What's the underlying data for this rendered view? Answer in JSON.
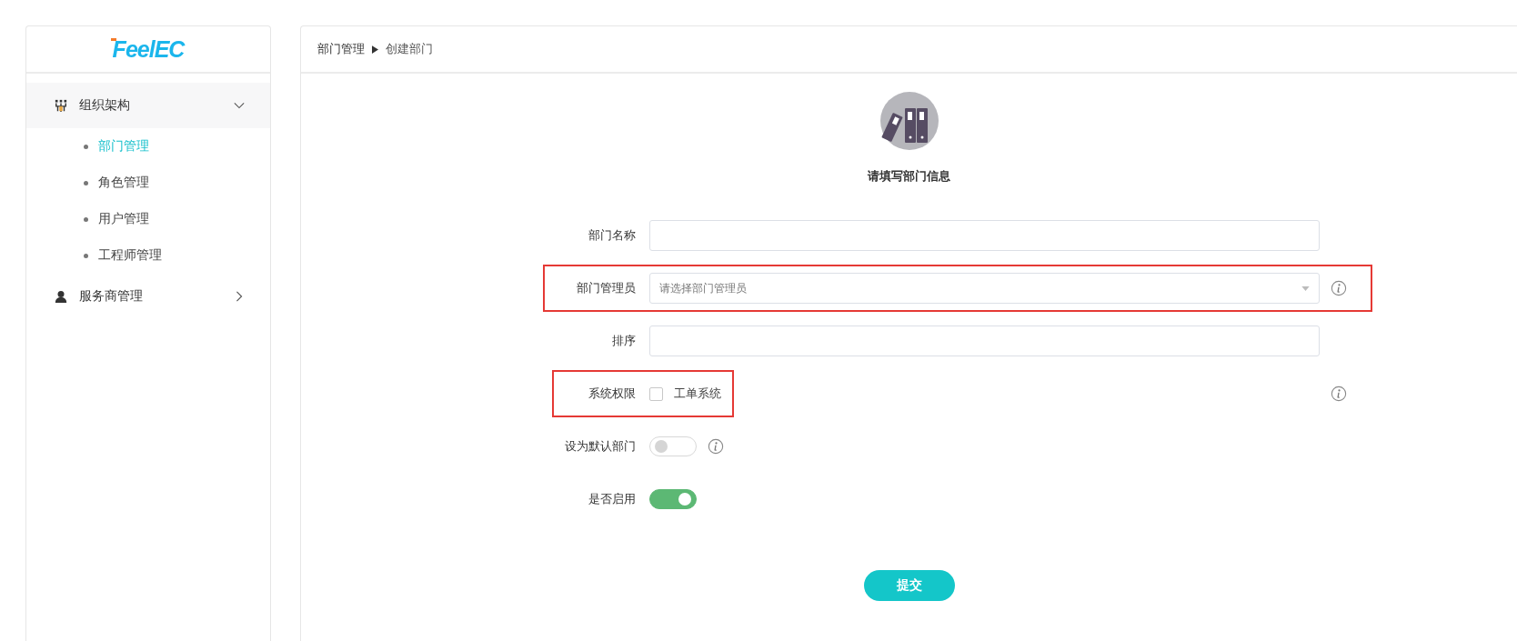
{
  "logo": {
    "text": "FeelEC"
  },
  "sidebar": {
    "groups": [
      {
        "label": "组织架构",
        "kind": "org",
        "expanded": true,
        "children": [
          {
            "label": "部门管理",
            "selected": true
          },
          {
            "label": "角色管理",
            "selected": false
          },
          {
            "label": "用户管理",
            "selected": false
          },
          {
            "label": "工程师管理",
            "selected": false
          }
        ]
      },
      {
        "label": "服务商管理",
        "kind": "person",
        "expanded": false
      }
    ]
  },
  "breadcrumb": [
    "部门管理",
    "创建部门"
  ],
  "form": {
    "title": "请填写部门信息",
    "fields": [
      {
        "label": "部门名称",
        "kind": "text",
        "highlighted": false,
        "info": false
      },
      {
        "label": "部门管理员",
        "kind": "select",
        "placeholder": "请选择部门管理员",
        "highlighted": true,
        "info": true
      },
      {
        "label": "排序",
        "kind": "text",
        "highlighted": false,
        "info": false
      },
      {
        "label": "系统权限",
        "kind": "checkbox",
        "option": "工单系统",
        "checked": false,
        "highlighted": true,
        "info": true
      },
      {
        "label": "设为默认部门",
        "kind": "toggle",
        "on": false,
        "highlighted": false,
        "info": true
      },
      {
        "label": "是否启用",
        "kind": "toggle",
        "on": true,
        "highlighted": false,
        "info": false
      }
    ],
    "submit": "提交"
  }
}
